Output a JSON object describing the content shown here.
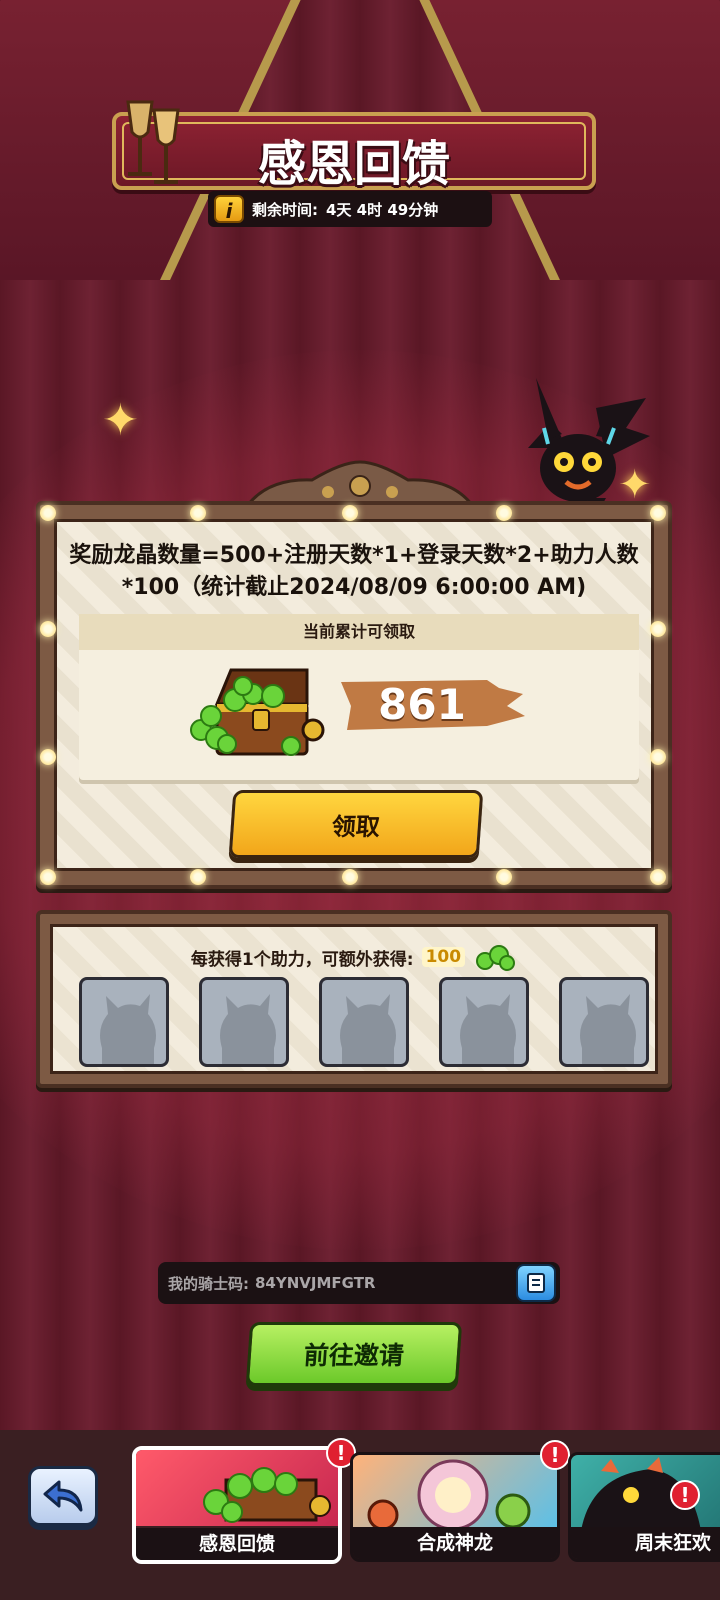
{
  "header": {
    "title": "感恩回馈",
    "timer_label": "剩余时间:",
    "timer_value": "4天 4时 49分钟"
  },
  "reward_board": {
    "formula": "奖励龙晶数量=500+注册天数*1+登录天数*2+助力人数*100（统计截止2024/08/09 6:00:00 AM)",
    "accumulated_label": "当前累计可领取",
    "amount": "861",
    "claim_label": "领取"
  },
  "helpers": {
    "bonus_label": "每获得1个助力，可额外获得:",
    "bonus_value": "100",
    "slot_count": 5
  },
  "knight_code": {
    "label": "我的骑士码:",
    "value": "84YNVJMFGTR"
  },
  "invite_label": "前往邀请",
  "tabs": [
    {
      "label": "感恩回馈",
      "active": true,
      "alert": true
    },
    {
      "label": "合成神龙",
      "active": false,
      "alert": true
    },
    {
      "label": "周末狂欢",
      "active": false,
      "alert": true
    }
  ],
  "colors": {
    "claim_button": "#f2a61a",
    "invite_button": "#6cc92a",
    "alert_badge": "#e02030",
    "amount_band": "#c07a44"
  },
  "icons": [
    "info-icon",
    "champagne-icon",
    "treasure-chest-icon",
    "gem-icon",
    "copy-icon",
    "back-arrow-icon",
    "alert-icon",
    "sparkle-icon"
  ]
}
